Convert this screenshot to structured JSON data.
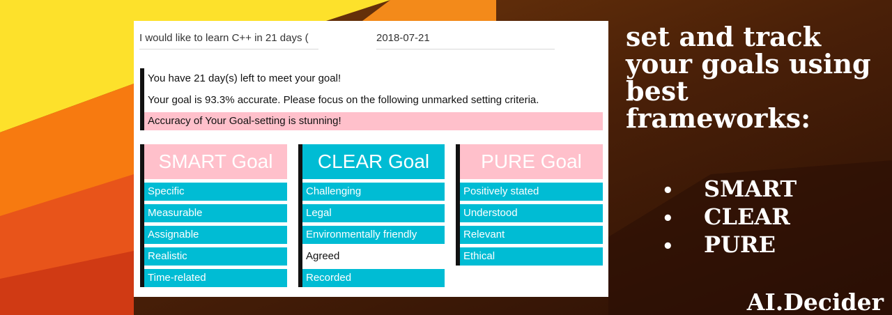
{
  "goal_form": {
    "goal_text": "I would like to learn C++ in 21 days (",
    "due_date": "2018-07-21"
  },
  "messages": {
    "days_left": "You have 21 day(s) left to meet your goal!",
    "accuracy": "Your goal is 93.3% accurate. Please focus on the following unmarked setting criteria.",
    "praise": "Accuracy of Your Goal-setting is stunning!"
  },
  "frameworks": [
    {
      "title": "SMART Goal",
      "title_color": "#ffc0cb",
      "items": [
        {
          "label": "Specific",
          "marked": true
        },
        {
          "label": "Measurable",
          "marked": true
        },
        {
          "label": "Assignable",
          "marked": true
        },
        {
          "label": "Realistic",
          "marked": true
        },
        {
          "label": "Time-related",
          "marked": true
        }
      ]
    },
    {
      "title": "CLEAR Goal",
      "title_color": "#00bcd4",
      "items": [
        {
          "label": "Challenging",
          "marked": true
        },
        {
          "label": "Legal",
          "marked": true
        },
        {
          "label": "Environmentally friendly",
          "marked": true
        },
        {
          "label": "Agreed",
          "marked": false
        },
        {
          "label": "Recorded",
          "marked": true
        }
      ]
    },
    {
      "title": "PURE Goal",
      "title_color": "#ffc0cb",
      "items": [
        {
          "label": "Positively stated",
          "marked": true
        },
        {
          "label": "Understood",
          "marked": true
        },
        {
          "label": "Relevant",
          "marked": true
        },
        {
          "label": "Ethical",
          "marked": true
        }
      ]
    }
  ],
  "promo": {
    "headline_lines": [
      "set and track",
      "your goals using",
      "best",
      "frameworks:"
    ],
    "bullet_glyph": "•",
    "framework_list": [
      "SMART",
      "CLEAR",
      "PURE"
    ],
    "brand": "AI.Decider"
  },
  "colors": {
    "marked": "#00bcd4",
    "pink": "#ffc0cb",
    "unmarked": "#ffffff",
    "accent_border": "#111111"
  }
}
